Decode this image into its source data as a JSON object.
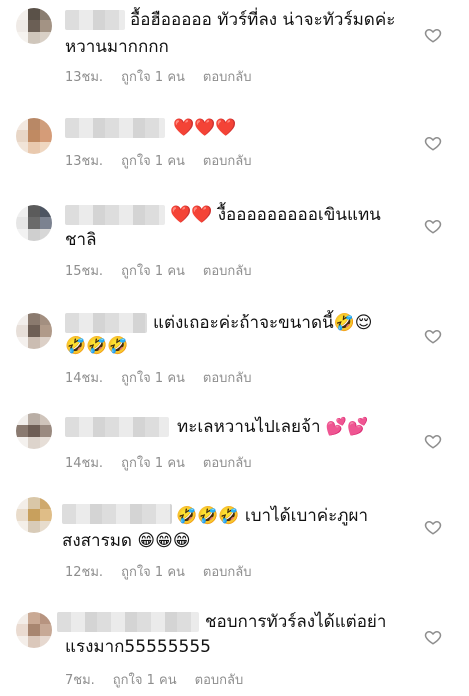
{
  "comments": [
    {
      "first": "อื้อฮือออออ ทัวร์ที่ลง น่าจะทัวร์มดค่ะ",
      "second": "หวานมากกกก",
      "time": "13ชม.",
      "likes": "ถูกใจ 1 คน",
      "reply": "ตอบกลับ",
      "avatar": [
        "#f4f0ec",
        "#5a5148",
        "#8a7d70",
        "#efeae6",
        "#6b5f55",
        "#a39384",
        "#f6f3ef",
        "#cfc6bb",
        "#d9d0c6"
      ]
    },
    {
      "first": "❤️❤️❤️",
      "second": "",
      "time": "13ชม.",
      "likes": "ถูกใจ 1 คน",
      "reply": "ตอบกลับ",
      "avatar": [
        "#f2e8e0",
        "#b88866",
        "#cf9e7c",
        "#e8d6c6",
        "#c08a62",
        "#d59c78",
        "#f1e4d8",
        "#e9c9ae",
        "#efd7c1"
      ]
    },
    {
      "first": "❤️❤️ งื้อออออออออเขินแทน",
      "second": "ชาลิ",
      "time": "15ชม.",
      "likes": "ถูกใจ 1 คน",
      "reply": "ตอบกลับ",
      "avatar": [
        "#efefef",
        "#5b5b5b",
        "#4d5562",
        "#e6e6e6",
        "#6a6a6a",
        "#7b8290",
        "#f2f2f2",
        "#cfcfcf",
        "#d7d7d7"
      ]
    },
    {
      "first": "แต่งเถอะค่ะถ้าจะขนาดนี้🤣😌",
      "second": "🤣🤣🤣",
      "time": "14ชม.",
      "likes": "ถูกใจ 1 คน",
      "reply": "ตอบกลับ",
      "avatar": [
        "#f2eeeb",
        "#8a7a6e",
        "#a38f80",
        "#e7dfd9",
        "#6e5f55",
        "#b09a89",
        "#f4f0ed",
        "#cbbdb2",
        "#dcd0c7"
      ]
    },
    {
      "first": "ทะเลหวานไปเลยจ้า 💕💕",
      "second": "",
      "time": "14ชม.",
      "likes": "ถูกใจ 1 คน",
      "reply": "ตอบกลับ",
      "avatar": [
        "#f2efec",
        "#b9aea5",
        "#cfc4bb",
        "#8a7a70",
        "#6e5e55",
        "#9a8a80",
        "#f4f1ee",
        "#ddd4cc",
        "#e6ded7"
      ]
    },
    {
      "first": "🤣🤣🤣 เบาได้เบาค่ะภูผา",
      "second": "สงสารมด 😁😁😁",
      "time": "12ชม.",
      "likes": "ถูกใจ 1 คน",
      "reply": "ตอบกลับ",
      "avatar": [
        "#f3eee8",
        "#d9c7a8",
        "#cfa96d",
        "#e9dccb",
        "#c8a05d",
        "#dfbd87",
        "#f4efe8",
        "#d8cbb8",
        "#e7dccd"
      ]
    },
    {
      "first": "ชอบการทัวร์ลงได้แต่อย่า",
      "second": "แรงมาก55555555",
      "time": "7ชม.",
      "likes": "ถูกใจ 1 คน",
      "reply": "ตอบกลับ",
      "avatar": [
        "#f3ede8",
        "#c9a994",
        "#b79480",
        "#eadbd1",
        "#a88670",
        "#c7a996",
        "#f4eee9",
        "#dbc8bb",
        "#e6d8cf"
      ]
    }
  ]
}
